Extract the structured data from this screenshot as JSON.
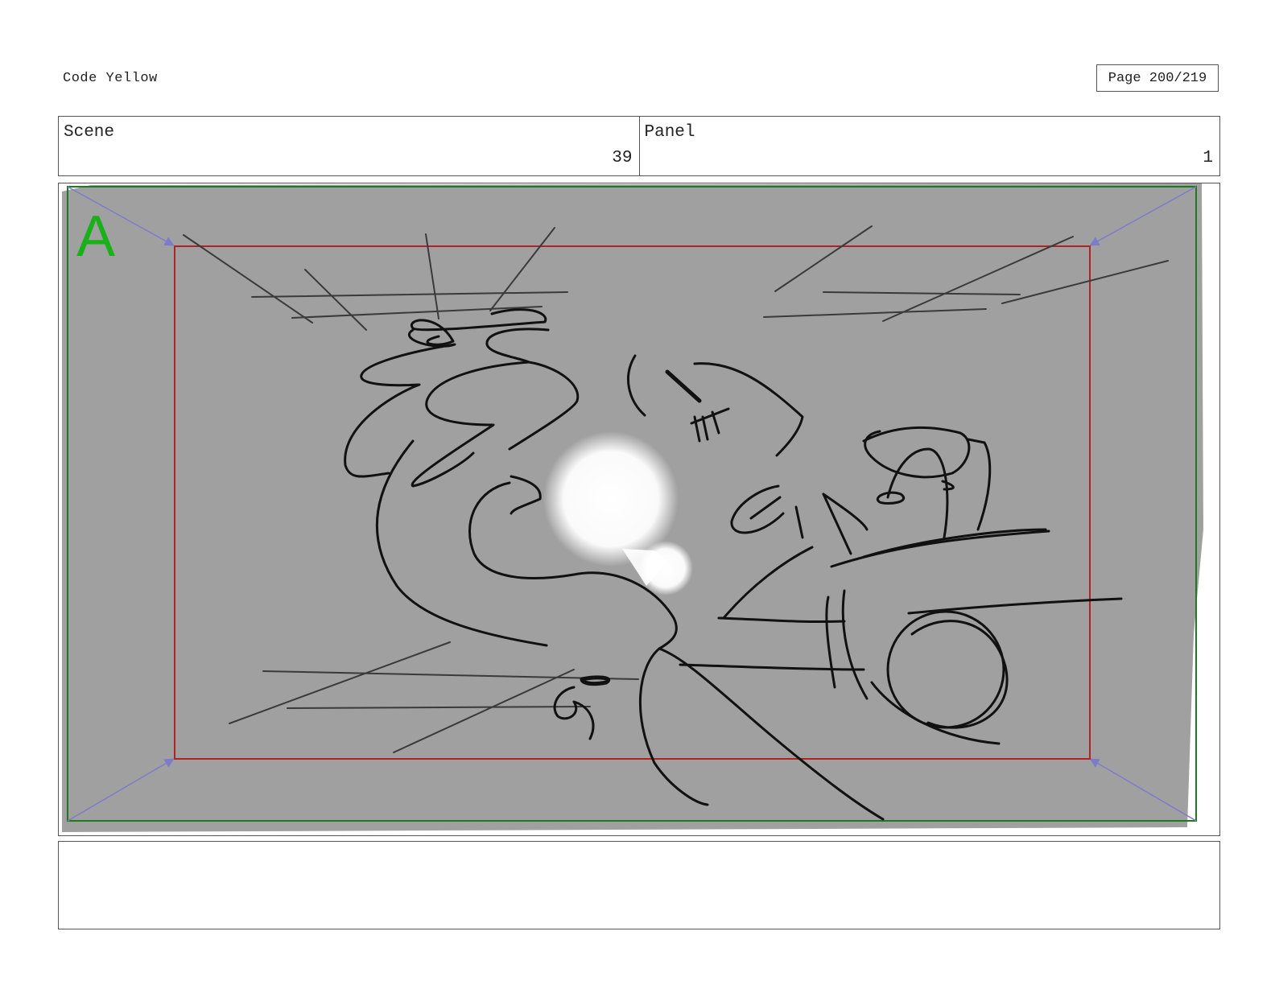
{
  "header": {
    "project_title": "Code Yellow",
    "page_counter": "Page 200/219"
  },
  "info": {
    "scene_label": "Scene",
    "scene_number": "39",
    "panel_label": "Panel",
    "panel_number": "1"
  },
  "frame": {
    "layer_marker": "A",
    "colors": {
      "background": "#a0a0a0",
      "safe_frame": "#1f7a1f",
      "action_frame": "#b22222",
      "guides": "#7c7cc9",
      "marker": "#19b019",
      "sketch": "#111111"
    }
  },
  "notes": {
    "text": ""
  }
}
